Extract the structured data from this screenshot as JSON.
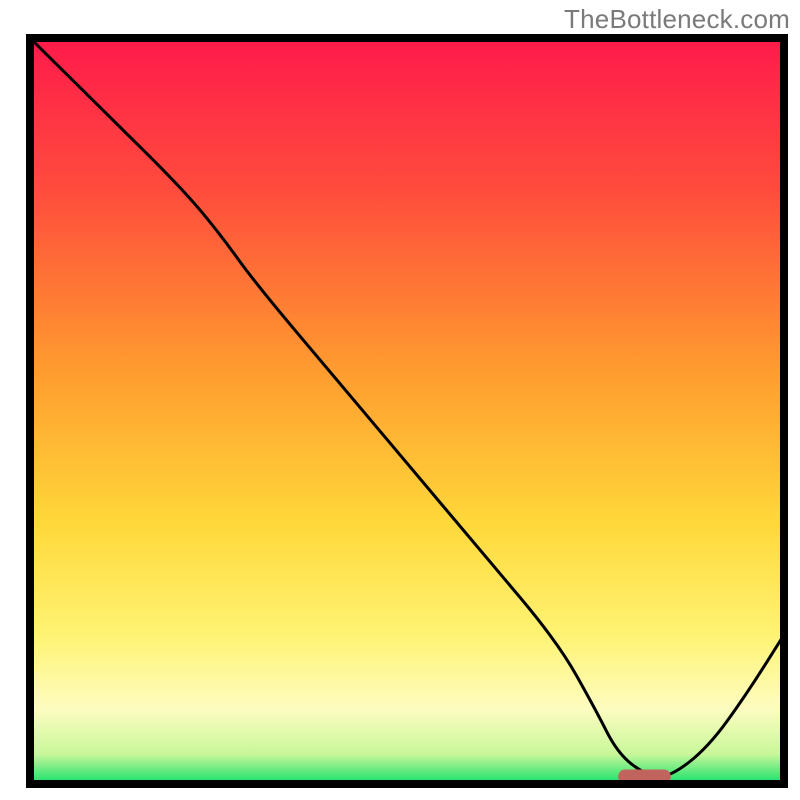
{
  "attribution": "TheBottleneck.com",
  "chart_data": {
    "type": "line",
    "title": "",
    "xlabel": "",
    "ylabel": "",
    "xlim": [
      0,
      100
    ],
    "ylim": [
      0,
      100
    ],
    "grid": false,
    "legend": false,
    "axes_visible": false,
    "background_gradient": {
      "stops": [
        {
          "offset": 0.0,
          "color": "#ff1a4b"
        },
        {
          "offset": 0.2,
          "color": "#ff4b3d"
        },
        {
          "offset": 0.45,
          "color": "#ff9d2f"
        },
        {
          "offset": 0.65,
          "color": "#ffd83a"
        },
        {
          "offset": 0.8,
          "color": "#fff373"
        },
        {
          "offset": 0.9,
          "color": "#fdfcc0"
        },
        {
          "offset": 0.96,
          "color": "#c8f79a"
        },
        {
          "offset": 1.0,
          "color": "#12e06a"
        }
      ]
    },
    "series": [
      {
        "name": "bottleneck-curve",
        "x": [
          0,
          10,
          20,
          25,
          30,
          40,
          50,
          60,
          70,
          75,
          78,
          82,
          85,
          90,
          95,
          100
        ],
        "y": [
          100,
          90,
          80,
          74,
          67,
          55,
          43,
          31,
          19,
          10,
          4,
          1,
          1,
          5,
          12,
          20
        ]
      }
    ],
    "marker": {
      "name": "optimal-range",
      "x_start": 78,
      "x_end": 85,
      "y": 1
    }
  }
}
